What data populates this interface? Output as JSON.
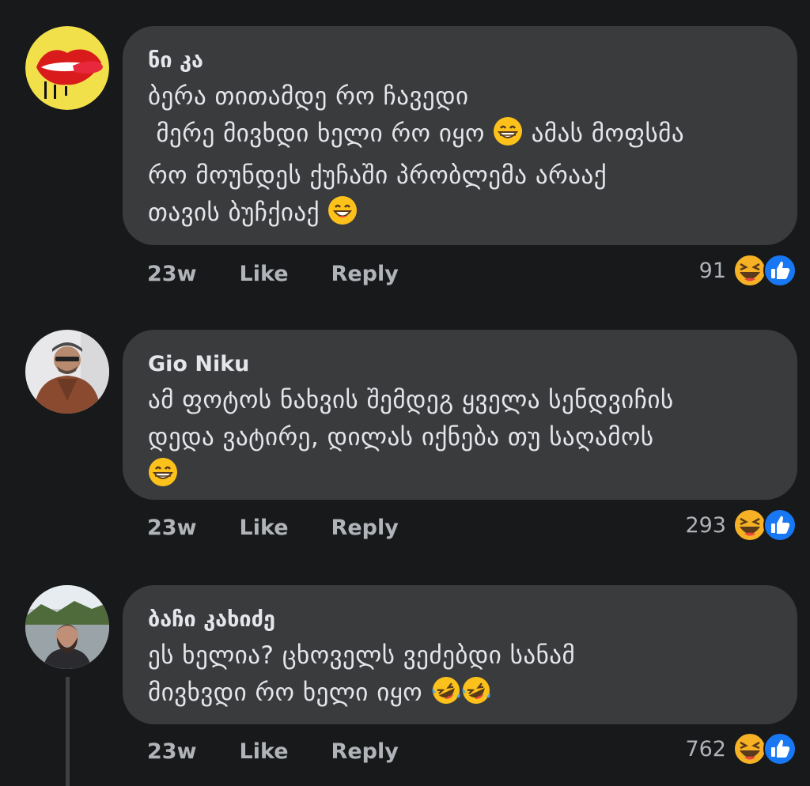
{
  "comments": [
    {
      "author": "ნი კა",
      "lines": [
        "ბერა თითამდე რო ჩავედი",
        " მერე მივხდი ხელი რო იყო",
        "ამას მოფსმა",
        "რო მოუნდეს ქუჩაში პრობლემა არააქ",
        "თავის ბუჩქიაქ"
      ],
      "time": "23w",
      "like_label": "Like",
      "reply_label": "Reply",
      "reaction_count": "91"
    },
    {
      "author": "Gio Niku",
      "lines": [
        "ამ ფოტოს ნახვის შემდეგ ყველა სენდვიჩის",
        "დედა ვატირე, დილას იქნება თუ საღამოს"
      ],
      "time": "23w",
      "like_label": "Like",
      "reply_label": "Reply",
      "reaction_count": "293"
    },
    {
      "author": "ბაჩი კახიძე",
      "lines": [
        "ეს ხელია? ცხოველს ვეძებდი სანამ",
        "მივხვდი რო ხელი იყო"
      ],
      "time": "23w",
      "like_label": "Like",
      "reply_label": "Reply",
      "reaction_count": "762"
    }
  ],
  "icons": {
    "grin": "grinning-face-icon",
    "smile": "smiling-face-icon",
    "rofl": "rolling-laughing-face-icon",
    "haha": "haha-reaction-icon",
    "like": "like-reaction-icon"
  },
  "colors": {
    "background": "#18191a",
    "bubble": "#3a3b3c",
    "text": "#e4e6eb",
    "secondary_text": "#b0b3b8",
    "like_blue": "#1877f2",
    "haha_yellow": "#f7b125"
  }
}
